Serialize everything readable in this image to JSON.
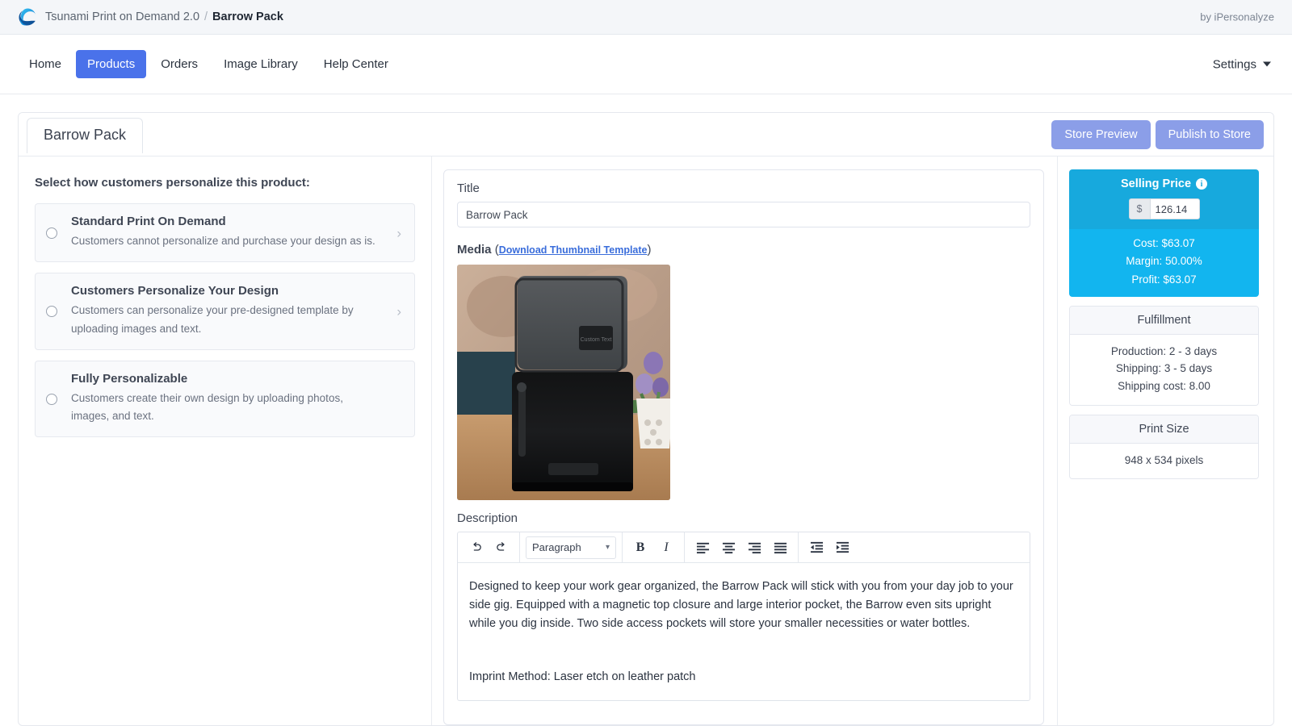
{
  "titlebar": {
    "app_name": "Tsunami Print on Demand 2.0",
    "separator": "/",
    "current": "Barrow Pack",
    "byline": "by iPersonalyze",
    "logo_icon": "edge-logo-icon"
  },
  "nav": {
    "items": [
      {
        "label": "Home",
        "active": false
      },
      {
        "label": "Products",
        "active": true
      },
      {
        "label": "Orders",
        "active": false
      },
      {
        "label": "Image Library",
        "active": false
      },
      {
        "label": "Help Center",
        "active": false
      }
    ],
    "settings_label": "Settings",
    "settings_icon": "chevron-down-icon",
    "active_color": "#4a72ea"
  },
  "card": {
    "tab_label": "Barrow Pack",
    "buttons": {
      "store_preview": "Store Preview",
      "publish": "Publish to Store"
    },
    "button_color": "#8b9ee8"
  },
  "left": {
    "section_title": "Select how customers personalize this product:",
    "options": [
      {
        "title": "Standard Print On Demand",
        "desc": "Customers cannot personalize and purchase your design as is.",
        "selected": false,
        "chevron": "›"
      },
      {
        "title": "Customers Personalize Your Design",
        "desc": "Customers can personalize your pre-designed template by uploading images and text.",
        "selected": false,
        "chevron": "›"
      },
      {
        "title": "Fully Personalizable",
        "desc": "Customers create their own design by uploading photos, images, and text.",
        "selected": false,
        "chevron": ""
      }
    ]
  },
  "center": {
    "title_label": "Title",
    "title_value": "Barrow Pack",
    "title_placeholder": "Barrow Pack",
    "media_label": "Media",
    "media_link": "Download Thumbnail Template",
    "media_paren_open": "(",
    "media_paren_close": ")",
    "thumbnail_alt": "Barrow Pack backpack on wooden table",
    "thumbnail_patch_text": "Custom Text",
    "description_label": "Description",
    "toolbar": {
      "undo_icon": "undo-icon",
      "redo_icon": "redo-icon",
      "block_format": "Paragraph",
      "bold_label": "B",
      "italic_label": "I",
      "align_left_icon": "align-left-icon",
      "align_center_icon": "align-center-icon",
      "align_right_icon": "align-right-icon",
      "align_justify_icon": "align-justify-icon",
      "outdent_icon": "outdent-icon",
      "indent_icon": "indent-icon"
    },
    "description_paragraphs": [
      "Designed to keep your work gear organized, the Barrow Pack will stick with you from your day job to your side gig. Equipped with a magnetic top closure and large interior pocket, the Barrow even sits upright while you dig inside. Two side access pockets will store your smaller necessities or water bottles.",
      "Imprint Method: Laser etch on leather patch"
    ]
  },
  "right": {
    "selling_price": {
      "label": "Selling Price",
      "info_icon": "info-icon",
      "currency_symbol": "$",
      "value": "126.14",
      "cost": "Cost: $63.07",
      "margin": "Margin: 50.00%",
      "profit": "Profit: $63.07",
      "header_color": "#17a9dd",
      "body_color": "#12b5ef"
    },
    "fulfillment": {
      "heading": "Fulfillment",
      "production": "Production: 2 - 3 days",
      "shipping": "Shipping: 3 - 5 days",
      "shipping_cost": "Shipping cost: 8.00"
    },
    "print_size": {
      "heading": "Print Size",
      "value": "948 x 534 pixels"
    }
  }
}
